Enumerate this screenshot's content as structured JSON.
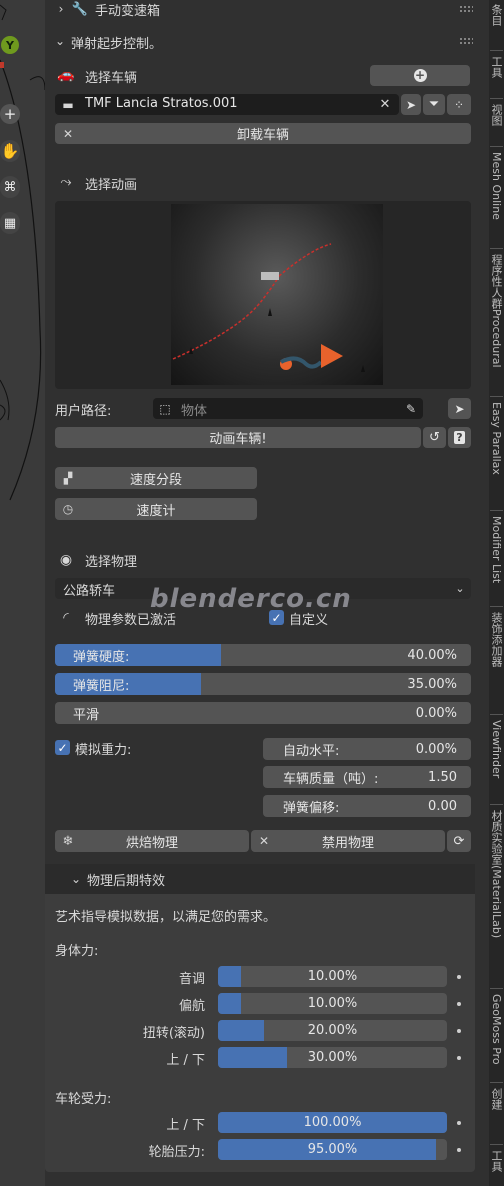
{
  "tabs": [
    "条目",
    "工具",
    "视图",
    "Mesh Online",
    "程序性人群Procedural",
    "Easy Parallax",
    "Modifier List",
    "装饰添加器",
    "Viewfinder",
    "材质实验室(MaterialLab)",
    "GeoMoss Pro",
    "创建",
    "工具"
  ],
  "panel": {
    "manual_shift_title": "手动变速箱",
    "launch_control_title": "弹射起步控制。",
    "select_vehicle_label": "选择车辆",
    "vehicle_name": "TMF Lancia Stratos.001",
    "unload_vehicle": "卸载车辆",
    "select_animation_label": "选择动画",
    "user_path_label": "用户路径:",
    "object_placeholder": "物体",
    "animate_vehicle": "动画车辆!",
    "speed_segment": "速度分段",
    "speedometer": "速度计",
    "select_physics_label": "选择物理",
    "physics_preset": "公路轿车",
    "physics_active": "物理参数已激活",
    "custom_label": "自定义",
    "spring_stiffness": {
      "label": "弹簧硬度:",
      "value": "40.00%",
      "fraction": 0.4
    },
    "spring_damping": {
      "label": "弹簧阻尼:",
      "value": "35.00%",
      "fraction": 0.35
    },
    "smooth": {
      "label": "平滑",
      "value": "0.00%",
      "fraction": 0.0
    },
    "simulate_gravity": "模拟重力:",
    "auto_level": {
      "label": "自动水平:",
      "value": "0.00%"
    },
    "vehicle_mass": {
      "label": "车辆质量（吨）:",
      "value": "1.50"
    },
    "spring_offset": {
      "label": "弹簧偏移:",
      "value": "0.00"
    },
    "bake_physics": "烘焙物理",
    "disable_physics": "禁用物理",
    "post_fx_title": "物理后期特效",
    "post_fx_desc": "艺术指导模拟数据，以满足您的需求。",
    "body_force_label": "身体力:",
    "body_force": [
      {
        "label": "音调",
        "value": "10.00%",
        "fraction": 0.1
      },
      {
        "label": "偏航",
        "value": "10.00%",
        "fraction": 0.1
      },
      {
        "label": "扭转(滚动)",
        "value": "20.00%",
        "fraction": 0.2
      },
      {
        "label": "上 / 下",
        "value": "30.00%",
        "fraction": 0.3
      }
    ],
    "wheel_force_label": "车轮受力:",
    "wheel_force": [
      {
        "label": "上 / 下",
        "value": "100.00%",
        "fraction": 1.0
      },
      {
        "label": "轮胎压力:",
        "value": "95.00%",
        "fraction": 0.95
      }
    ]
  },
  "watermark": "blenderco.cn",
  "viewport_axis_label": "Y",
  "colors": {
    "accent": "#4772b3",
    "panel": "#303030",
    "widget": "#545454",
    "subpanel": "#3d3d3d",
    "orange": "#e8622c"
  }
}
